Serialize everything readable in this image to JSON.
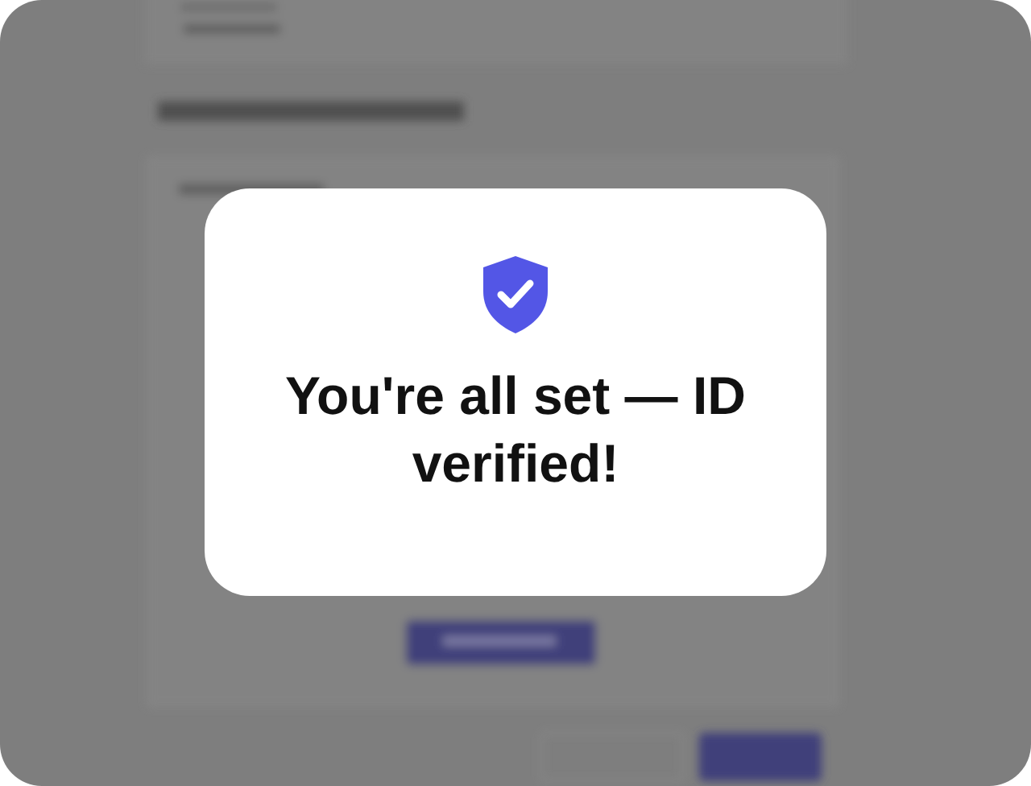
{
  "dialog": {
    "message": "You're all set — ID verified!"
  }
}
